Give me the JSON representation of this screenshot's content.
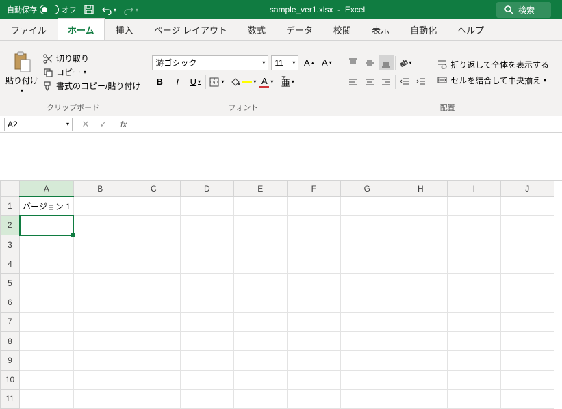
{
  "titlebar": {
    "autosave_label": "自動保存",
    "autosave_state": "オフ",
    "filename": "sample_ver1.xlsx",
    "app_name": "Excel",
    "search_label": "検索"
  },
  "tabs": {
    "items": [
      {
        "label": "ファイル"
      },
      {
        "label": "ホーム"
      },
      {
        "label": "挿入"
      },
      {
        "label": "ページ レイアウト"
      },
      {
        "label": "数式"
      },
      {
        "label": "データ"
      },
      {
        "label": "校閲"
      },
      {
        "label": "表示"
      },
      {
        "label": "自動化"
      },
      {
        "label": "ヘルプ"
      }
    ],
    "active_index": 1
  },
  "ribbon": {
    "clipboard": {
      "paste_label": "貼り付け",
      "cut_label": "切り取り",
      "copy_label": "コピー",
      "format_painter_label": "書式のコピー/貼り付け",
      "group_label": "クリップボード"
    },
    "font": {
      "font_name": "游ゴシック",
      "font_size": "11",
      "group_label": "フォント"
    },
    "alignment": {
      "wrap_label": "折り返して全体を表示する",
      "merge_label": "セルを結合して中央揃え",
      "group_label": "配置"
    }
  },
  "formula_bar": {
    "name_box_value": "A2",
    "fx_label": "fx",
    "formula_value": ""
  },
  "grid": {
    "columns": [
      "A",
      "B",
      "C",
      "D",
      "E",
      "F",
      "G",
      "H",
      "I",
      "J"
    ],
    "row_count": 11,
    "cells": {
      "A1": "バージョン 1"
    },
    "active_cell": "A2",
    "selected_col": "A",
    "selected_row": 2
  }
}
